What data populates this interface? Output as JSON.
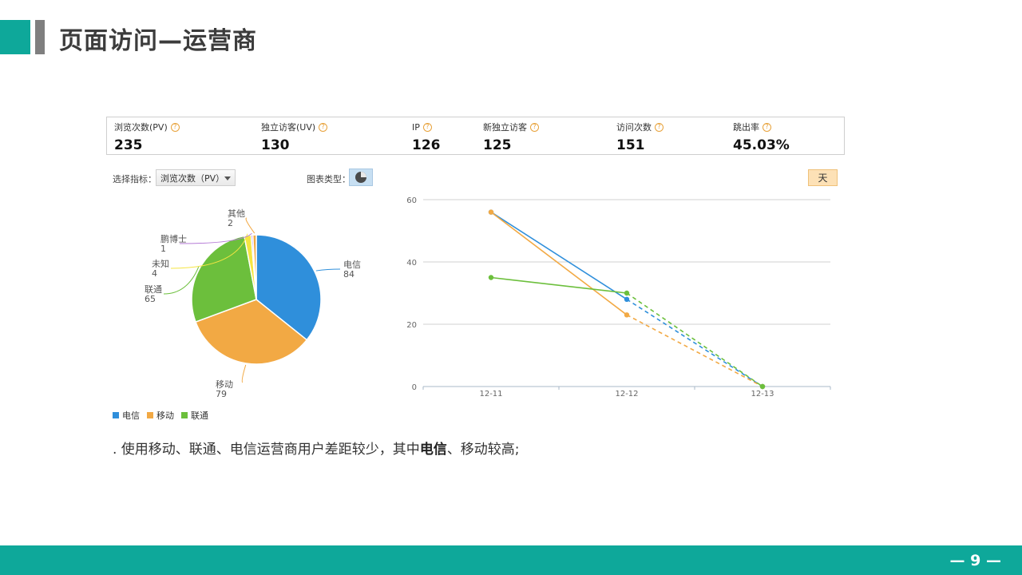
{
  "header": {
    "title": "页面访问—运营商"
  },
  "stats": [
    {
      "label": "浏览次数(PV)",
      "value": "235"
    },
    {
      "label": "独立访客(UV)",
      "value": "130"
    },
    {
      "label": "IP",
      "value": "126"
    },
    {
      "label": "新独立访客",
      "value": "125"
    },
    {
      "label": "访问次数",
      "value": "151"
    },
    {
      "label": "跳出率",
      "value": "45.03%"
    }
  ],
  "controls": {
    "metric_label": "选择指标：",
    "metric_selected": "浏览次数（PV）",
    "chart_type_label": "图表类型：",
    "period_button": "天"
  },
  "legend": [
    "电信",
    "移动",
    "联通"
  ],
  "summary": {
    "prefix": ". 使用移动、联通、电信运营商用户差距较少，其中",
    "highlight": "电信",
    "suffix": "、移动较高;"
  },
  "footer": {
    "page_number": "— 9 —"
  },
  "colors": {
    "teal": "#0ea89a",
    "telecom": "#2f8fdb",
    "mobile": "#f2a944",
    "unicom": "#6cbf3c",
    "unknown": "#f5e542",
    "aijieshi": "#b57bd6",
    "other": "#f2a944"
  },
  "chart_data": [
    {
      "type": "pie",
      "slices": [
        {
          "name": "电信",
          "value": 84,
          "color": "#2f8fdb"
        },
        {
          "name": "移动",
          "value": 79,
          "color": "#f2a944"
        },
        {
          "name": "联通",
          "value": 65,
          "color": "#6cbf3c"
        },
        {
          "name": "未知",
          "value": 4,
          "color": "#f5e542"
        },
        {
          "name": "鹏博士",
          "value": 1,
          "color": "#b57bd6"
        },
        {
          "name": "其他",
          "value": 2,
          "color": "#f2a944"
        }
      ]
    },
    {
      "type": "line",
      "x": [
        "12-11",
        "12-12",
        "12-13"
      ],
      "ylim": [
        0,
        60
      ],
      "yticks": [
        0,
        20,
        40,
        60
      ],
      "series": [
        {
          "name": "电信",
          "color": "#2f8fdb",
          "values": [
            56,
            28,
            0
          ]
        },
        {
          "name": "移动",
          "color": "#f2a944",
          "values": [
            56,
            23,
            0
          ]
        },
        {
          "name": "联通",
          "color": "#6cbf3c",
          "values": [
            35,
            30,
            0
          ]
        }
      ]
    }
  ]
}
